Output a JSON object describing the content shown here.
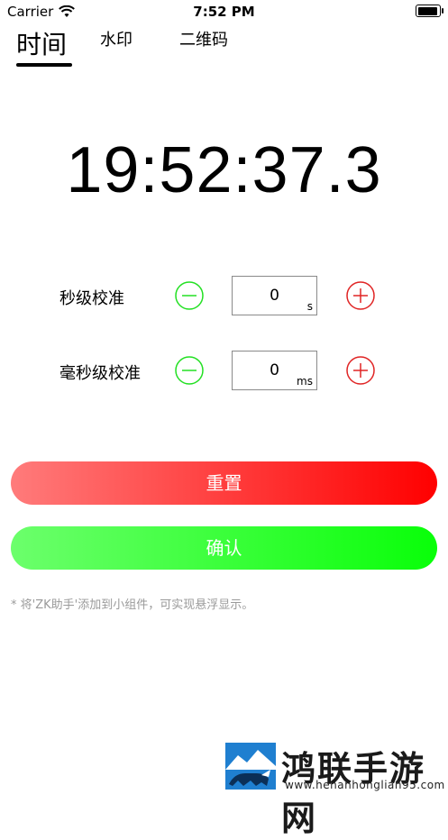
{
  "status_bar": {
    "carrier": "Carrier",
    "time": "7:52 PM"
  },
  "tabs": [
    {
      "label": "时间",
      "active": true
    },
    {
      "label": "水印",
      "active": false
    },
    {
      "label": "二维码",
      "active": false
    }
  ],
  "clock": {
    "value": "19:52:37.3"
  },
  "calibration": [
    {
      "label": "秒级校准",
      "value": "0",
      "unit": "s"
    },
    {
      "label": "毫秒级校准",
      "value": "0",
      "unit": "ms"
    }
  ],
  "buttons": {
    "reset": "重置",
    "confirm": "确认"
  },
  "note": "* 将'ZK助手'添加到小组件，可实现悬浮显示。",
  "watermark": {
    "title": "鸿联手游网",
    "url": "www.henanhonglian95.com"
  },
  "colors": {
    "minus": "#22e022",
    "plus": "#e02424",
    "reset_start": "#ff7b7b",
    "reset_end": "#ff0000",
    "confirm_start": "#6cff6c",
    "confirm_end": "#09ff09"
  }
}
